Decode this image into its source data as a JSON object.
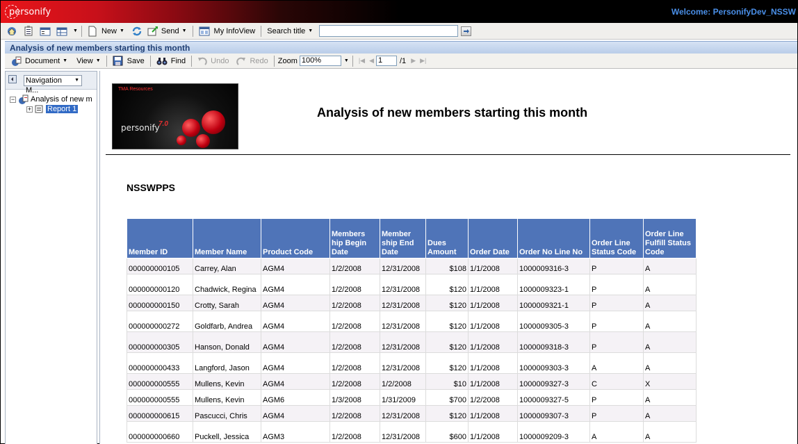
{
  "brand": {
    "logo_text": "personify",
    "welcome": "Welcome:  PersonifyDev_NSSW"
  },
  "toolbar": {
    "new_label": "New",
    "send_label": "Send",
    "my_infoview_label": "My InfoView",
    "search_title_label": "Search title",
    "search_value": ""
  },
  "document": {
    "title": "Analysis of new members starting this month",
    "toolbar": {
      "document_label": "Document",
      "view_label": "View",
      "save_label": "Save",
      "find_label": "Find",
      "undo_label": "Undo",
      "redo_label": "Redo",
      "zoom_label": "Zoom",
      "zoom_value": "100%",
      "page_value": "1",
      "page_total": "/1"
    }
  },
  "navigation": {
    "mode_label": "Navigation M...",
    "tree": {
      "root_label": "Analysis of new m",
      "child_label": "Report 1"
    }
  },
  "report": {
    "logo": {
      "tag": "TMA Resources",
      "word": "personify",
      "version": "7.0"
    },
    "title": "Analysis of new members starting this month",
    "org": "NSSWPPS",
    "columns": [
      "Member ID",
      "Member Name",
      "Product Code",
      "Members hip Begin Date",
      "Member ship End Date",
      "Dues Amount",
      "Order Date",
      "Order No Line No",
      "Order Line Status Code",
      "Order Line Fulfill Status Code"
    ],
    "rows": [
      [
        "000000000105",
        "Carrey, Alan",
        "AGM4",
        "1/2/2008",
        "12/31/2008",
        "$108",
        "1/1/2008",
        "1000009316-3",
        "P",
        "A"
      ],
      [
        "000000000120",
        "Chadwick, Regina",
        "AGM4",
        "1/2/2008",
        "12/31/2008",
        "$120",
        "1/1/2008",
        "1000009323-1",
        "P",
        "A"
      ],
      [
        "000000000150",
        "Crotty, Sarah",
        "AGM4",
        "1/2/2008",
        "12/31/2008",
        "$120",
        "1/1/2008",
        "1000009321-1",
        "P",
        "A"
      ],
      [
        "000000000272",
        "Goldfarb, Andrea",
        "AGM4",
        "1/2/2008",
        "12/31/2008",
        "$120",
        "1/1/2008",
        "1000009305-3",
        "P",
        "A"
      ],
      [
        "000000000305",
        "Hanson, Donald",
        "AGM4",
        "1/2/2008",
        "12/31/2008",
        "$120",
        "1/1/2008",
        "1000009318-3",
        "P",
        "A"
      ],
      [
        "000000000433",
        "Langford, Jason",
        "AGM4",
        "1/2/2008",
        "12/31/2008",
        "$120",
        "1/1/2008",
        "1000009303-3",
        "A",
        "A"
      ],
      [
        "000000000555",
        "Mullens, Kevin",
        "AGM4",
        "1/2/2008",
        "1/2/2008",
        "$10",
        "1/1/2008",
        "1000009327-3",
        "C",
        "X"
      ],
      [
        "000000000555",
        "Mullens, Kevin",
        "AGM6",
        "1/3/2008",
        "1/31/2009",
        "$700",
        "1/2/2008",
        "1000009327-5",
        "P",
        "A"
      ],
      [
        "000000000615",
        "Pascucci, Chris",
        "AGM4",
        "1/2/2008",
        "12/31/2008",
        "$120",
        "1/1/2008",
        "1000009307-3",
        "P",
        "A"
      ],
      [
        "000000000660",
        "Puckell, Jessica",
        "AGM3",
        "1/2/2008",
        "12/31/2008",
        "$600",
        "1/1/2008",
        "1000009209-3",
        "A",
        "A"
      ]
    ]
  }
}
